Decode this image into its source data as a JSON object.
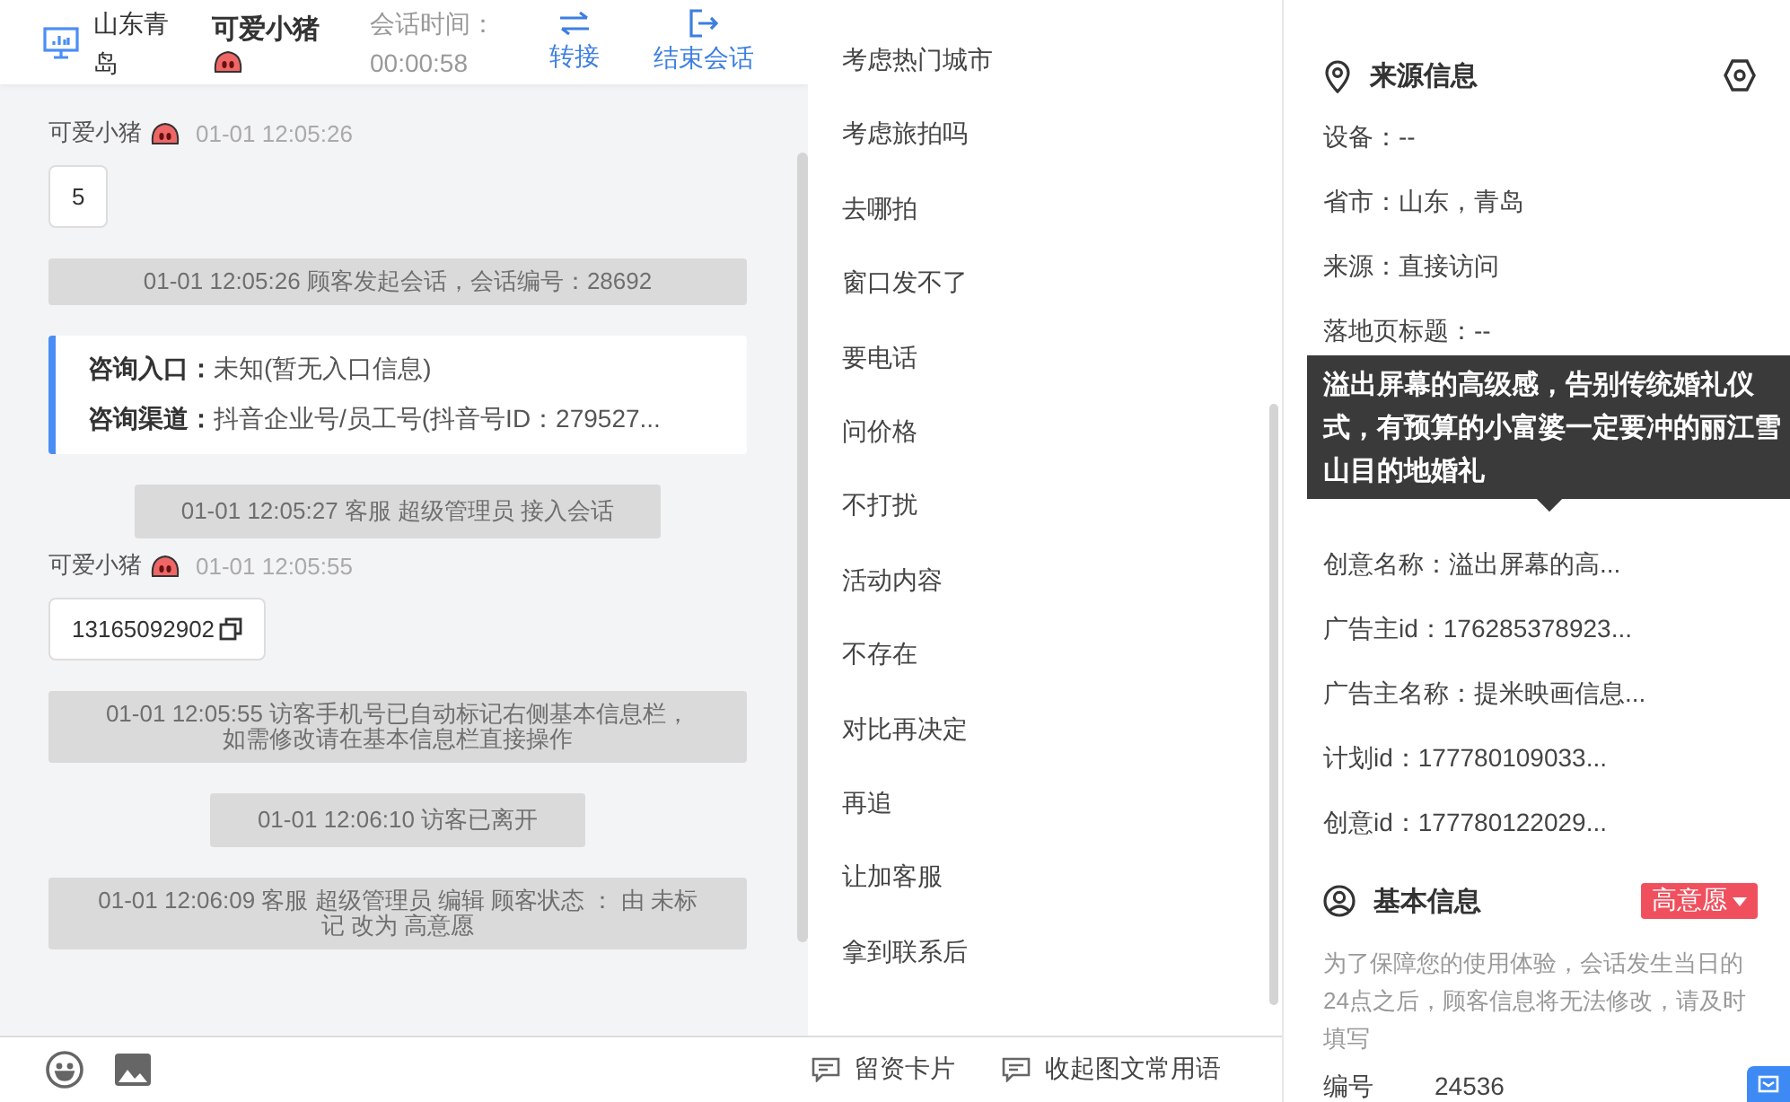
{
  "header": {
    "location": "山东青岛",
    "visitor": "可爱小猪",
    "timer_label": "会话时间：",
    "timer": "00:00:58",
    "actions": [
      {
        "label": "转接",
        "kind": "transfer"
      },
      {
        "label": "结束会话",
        "kind": "end"
      }
    ]
  },
  "messages": [
    {
      "kind": "visitor",
      "sender": "可爱小猪",
      "time": "01-01 12:05:26",
      "text": "5",
      "copyable": false
    },
    {
      "kind": "system",
      "text": "01-01 12:05:26 顾客发起会话，会话编号：28692"
    },
    {
      "kind": "info",
      "rows": [
        {
          "label": "咨询入口：",
          "value": "未知(暂无入口信息)"
        },
        {
          "label": "咨询渠道：",
          "value": "抖音企业号/员工号(抖音号ID：279527..."
        }
      ]
    },
    {
      "kind": "system",
      "text": "01-01 12:05:27 客服 超级管理员 接入会话"
    },
    {
      "kind": "visitor",
      "sender": "可爱小猪",
      "time": "01-01 12:05:55",
      "text": "13165092902",
      "copyable": true
    },
    {
      "kind": "system",
      "text": "01-01 12:05:55 访客手机号已自动标记右侧基本信息栏，如需修改请在基本信息栏直接操作"
    },
    {
      "kind": "system",
      "text": "01-01 12:06:10 访客已离开"
    },
    {
      "kind": "system",
      "text": "01-01 12:06:09 客服 超级管理员 编辑 顾客状态 ： 由 未标记 改为 高意愿"
    }
  ],
  "phrases": [
    "考虑热门城市",
    "考虑旅拍吗",
    "去哪拍",
    "窗口发不了",
    "要电话",
    "问价格",
    "不打扰",
    "活动内容",
    "不存在",
    "对比再决定",
    "再追",
    "让加客服",
    "拿到联系后"
  ],
  "phrase_footer": [
    "留资卡片",
    "收起图文常用语"
  ],
  "source_info": {
    "title": "来源信息",
    "fields_before": [
      "设备：--",
      "省市：山东，青岛",
      "来源：直接访问",
      "落地页标题：--"
    ],
    "tooltip": "溢出屏幕的高级感，告别传统婚礼仪式，有预算的小富婆一定要冲的丽江雪山目的地婚礼",
    "fields_after": [
      "创意名称：溢出屏幕的高...",
      "广告主id：176285378923...",
      "广告主名称：提米映画信息...",
      "计划id：177780109033...",
      "创意id：177780122029..."
    ]
  },
  "basic_info": {
    "title": "基本信息",
    "status": "高意愿",
    "notice": "为了保障您的使用体验，会话发生当日的24点之后，顾客信息将无法修改，请及时填写",
    "fields": [
      {
        "label": "编号",
        "value": "24536"
      }
    ]
  }
}
